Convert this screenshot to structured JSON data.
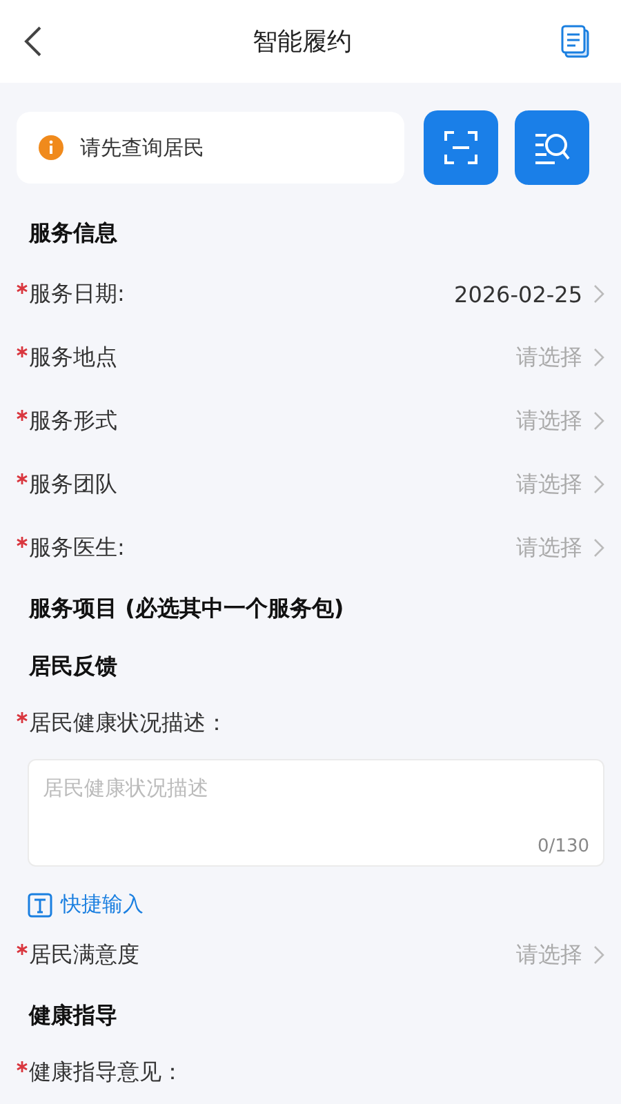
{
  "header": {
    "title": "智能履约"
  },
  "notice": {
    "text": "请先查询居民"
  },
  "form": [
    {
      "kind": "heading",
      "text": "服务信息"
    },
    {
      "kind": "select",
      "label": "服务日期:",
      "required": true,
      "value": "2026-02-25"
    },
    {
      "kind": "select",
      "label": "服务地点",
      "required": true,
      "placeholder": "请选择"
    },
    {
      "kind": "select",
      "label": "服务形式",
      "required": true,
      "placeholder": "请选择"
    },
    {
      "kind": "select",
      "label": "服务团队",
      "required": true,
      "placeholder": "请选择"
    },
    {
      "kind": "select",
      "label": "服务医生:",
      "required": true,
      "placeholder": "请选择"
    },
    {
      "kind": "heading",
      "text": "服务项目 (必选其中一个服务包)"
    },
    {
      "kind": "heading",
      "text": "居民反馈"
    },
    {
      "kind": "label",
      "label": "居民健康状况描述：",
      "required": true
    },
    {
      "kind": "textarea",
      "placeholder": "居民健康状况描述",
      "counter": "0/130"
    },
    {
      "kind": "quick_input",
      "text": "快捷输入"
    },
    {
      "kind": "select",
      "label": "居民满意度",
      "required": true,
      "placeholder": "请选择"
    },
    {
      "kind": "heading",
      "text": "健康指导"
    },
    {
      "kind": "label",
      "label": "健康指导意见：",
      "required": true
    }
  ]
}
